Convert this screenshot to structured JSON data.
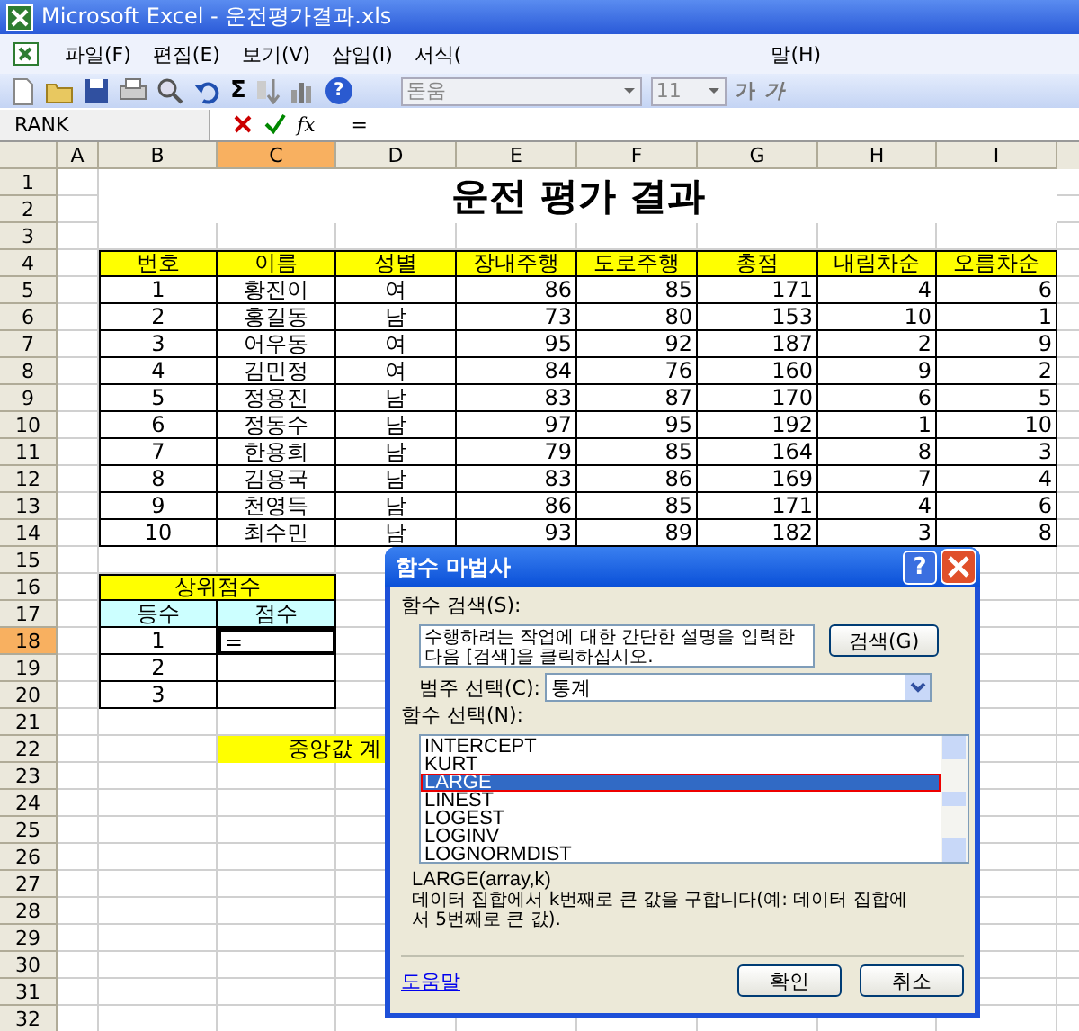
{
  "window": {
    "title": "Microsoft Excel - 운전평가결과.xls"
  },
  "menu": [
    {
      "label": "파일(F)"
    },
    {
      "label": "편집(E)"
    },
    {
      "label": "보기(V)"
    },
    {
      "label": "삽입(I)"
    },
    {
      "label": "서식("
    },
    {
      "label": "말(H)"
    }
  ],
  "toolbar": {
    "help": "?",
    "autosum": "Σ",
    "font": "돋움",
    "size": "11",
    "bold": "가",
    "italic": "가"
  },
  "formula_bar": {
    "name_box": "RANK",
    "fx": "fx",
    "formula": "="
  },
  "columns": [
    {
      "label": "A",
      "selected": false
    },
    {
      "label": "B",
      "selected": false
    },
    {
      "label": "C",
      "selected": true
    },
    {
      "label": "D",
      "selected": false
    },
    {
      "label": "E",
      "selected": false
    },
    {
      "label": "F",
      "selected": false
    },
    {
      "label": "G",
      "selected": false
    },
    {
      "label": "H",
      "selected": false
    },
    {
      "label": "I",
      "selected": false
    }
  ],
  "rows": [
    {
      "label": "1",
      "selected": false
    },
    {
      "label": "2",
      "selected": false
    },
    {
      "label": "3",
      "selected": false
    },
    {
      "label": "4",
      "selected": false
    },
    {
      "label": "5",
      "selected": false
    },
    {
      "label": "6",
      "selected": false
    },
    {
      "label": "7",
      "selected": false
    },
    {
      "label": "8",
      "selected": false
    },
    {
      "label": "9",
      "selected": false
    },
    {
      "label": "10",
      "selected": false
    },
    {
      "label": "11",
      "selected": false
    },
    {
      "label": "12",
      "selected": false
    },
    {
      "label": "13",
      "selected": false
    },
    {
      "label": "14",
      "selected": false
    },
    {
      "label": "15",
      "selected": false
    },
    {
      "label": "16",
      "selected": false
    },
    {
      "label": "17",
      "selected": false
    },
    {
      "label": "18",
      "selected": true
    },
    {
      "label": "19",
      "selected": false
    },
    {
      "label": "20",
      "selected": false
    },
    {
      "label": "21",
      "selected": false
    },
    {
      "label": "22",
      "selected": false
    },
    {
      "label": "23",
      "selected": false
    },
    {
      "label": "24",
      "selected": false
    },
    {
      "label": "25",
      "selected": false
    },
    {
      "label": "26",
      "selected": false
    },
    {
      "label": "27",
      "selected": false
    },
    {
      "label": "28",
      "selected": false
    },
    {
      "label": "29",
      "selected": false
    },
    {
      "label": "30",
      "selected": false
    },
    {
      "label": "31",
      "selected": false
    },
    {
      "label": "32",
      "selected": false
    }
  ],
  "sheet": {
    "title": "운전 평가 결과",
    "table": {
      "columns": [
        "번호",
        "이름",
        "성별",
        "장내주행",
        "도로주행",
        "총점",
        "내림차순",
        "오름차순"
      ],
      "rows": [
        [
          "1",
          "황진이",
          "여",
          "86",
          "85",
          "171",
          "4",
          "6"
        ],
        [
          "2",
          "홍길동",
          "남",
          "73",
          "80",
          "153",
          "10",
          "1"
        ],
        [
          "3",
          "어우동",
          "여",
          "95",
          "92",
          "187",
          "2",
          "9"
        ],
        [
          "4",
          "김민정",
          "여",
          "84",
          "76",
          "160",
          "9",
          "2"
        ],
        [
          "5",
          "정용진",
          "남",
          "83",
          "87",
          "170",
          "6",
          "5"
        ],
        [
          "6",
          "정동수",
          "남",
          "97",
          "95",
          "192",
          "1",
          "10"
        ],
        [
          "7",
          "한용희",
          "남",
          "79",
          "85",
          "164",
          "8",
          "3"
        ],
        [
          "8",
          "김용국",
          "남",
          "83",
          "86",
          "169",
          "7",
          "4"
        ],
        [
          "9",
          "천영득",
          "남",
          "86",
          "85",
          "171",
          "4",
          "6"
        ],
        [
          "10",
          "최수민",
          "남",
          "93",
          "89",
          "182",
          "3",
          "8"
        ]
      ]
    },
    "top_scores": {
      "title": "상위점수",
      "columns": [
        "등수",
        "점수"
      ],
      "rows": [
        {
          "rank": "1",
          "score": "="
        },
        {
          "rank": "2"
        },
        {
          "rank": "3"
        }
      ]
    },
    "median_label": "중앙값 계"
  },
  "dialog": {
    "title": "함수 마법사",
    "help_button": "?",
    "search_label": "함수 검색(S):",
    "search_value": "수행하려는 작업에 대한 간단한 설명을 입력한 다음 [검색]을 클릭하십시오.",
    "search_button": "검색(G)",
    "category_label": "범주 선택(C):",
    "category_value": "통계",
    "function_label": "함수 선택(N):",
    "functions": [
      {
        "name": "INTERCEPT",
        "selected": false
      },
      {
        "name": "KURT",
        "selected": false
      },
      {
        "name": "LARGE",
        "selected": true
      },
      {
        "name": "LINEST",
        "selected": false
      },
      {
        "name": "LOGEST",
        "selected": false
      },
      {
        "name": "LOGINV",
        "selected": false
      },
      {
        "name": "LOGNORMDIST",
        "selected": false
      }
    ],
    "syntax": "LARGE(array,k)",
    "description": "데이터 집합에서 k번째로 큰 값을 구합니다(예: 데이터 집합에서 5번째로 큰 값).",
    "help_link": "도움말",
    "ok": "확인",
    "cancel": "취소"
  }
}
